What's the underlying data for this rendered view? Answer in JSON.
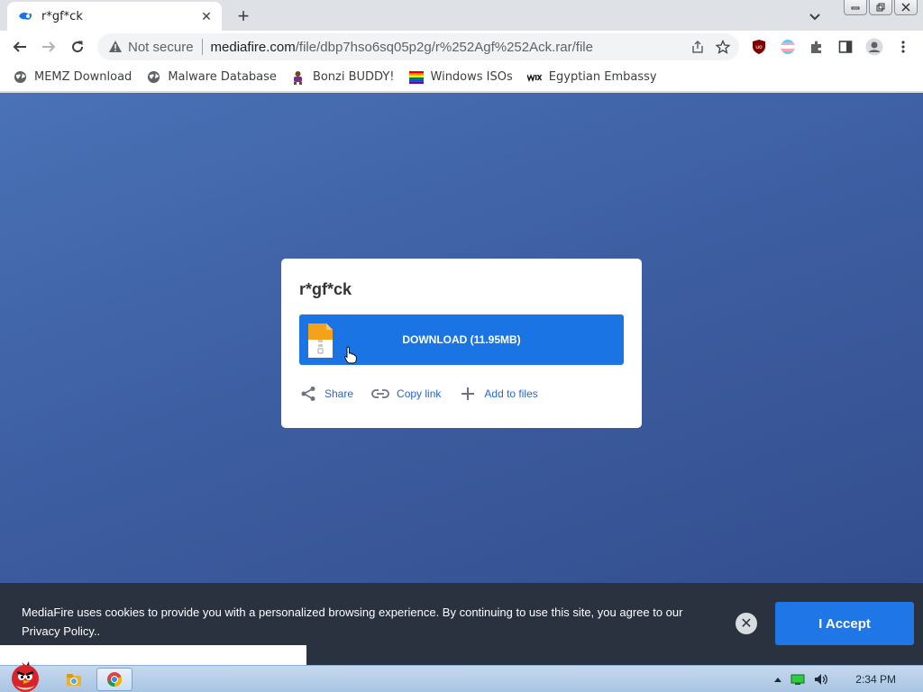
{
  "tab": {
    "title": "r*gf*ck",
    "close": "✕"
  },
  "newtab": "+",
  "omnibox": {
    "security": "Not secure",
    "url_domain": "mediafire.com",
    "url_path": "/file/dbp7hso6sq05p2g/r%252Agf%252Ack.rar/file"
  },
  "bookmarks": [
    {
      "label": "MEMZ Download",
      "icon": "globe-icon"
    },
    {
      "label": "Malware Database",
      "icon": "globe-icon"
    },
    {
      "label": "Bonzi BUDDY!",
      "icon": "bonzi-icon"
    },
    {
      "label": "Windows ISOs",
      "icon": "rainbow-flag-icon"
    },
    {
      "label": "Egyptian Embassy",
      "icon": "wix-icon"
    }
  ],
  "card": {
    "title": "r*gf*ck",
    "download_label": "DOWNLOAD (11.95MB)",
    "actions": [
      {
        "label": "Share",
        "icon": "share-icon"
      },
      {
        "label": "Copy link",
        "icon": "link-icon"
      },
      {
        "label": "Add to files",
        "icon": "plus-icon"
      }
    ]
  },
  "cookie": {
    "text": "MediaFire uses cookies to provide you with a personalized browsing experience. By continuing to use this site, you agree to our Privacy Policy..",
    "accept_label": "I Accept",
    "close": "✕"
  },
  "taskbar": {
    "clock": "2:34 PM"
  },
  "colors": {
    "accent": "#1b74e4",
    "page_bg": "#3e5fa3",
    "banner_bg": "#2a3240"
  }
}
